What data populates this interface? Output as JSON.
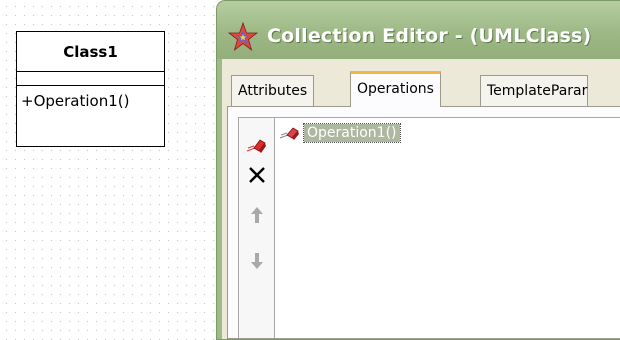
{
  "uml_class": {
    "name": "Class1",
    "operations": [
      "+Operation1()"
    ]
  },
  "window": {
    "title": "Collection Editor - (UMLClass)",
    "icon": "star-icon"
  },
  "tabs": [
    {
      "label": "Attributes",
      "active": false
    },
    {
      "label": "Operations",
      "active": true
    },
    {
      "label": "TemplateParar",
      "active": false
    }
  ],
  "toolbar": {
    "items": [
      {
        "icon": "add-operation-icon",
        "enabled": true
      },
      {
        "icon": "delete-icon",
        "enabled": true
      },
      {
        "icon": "move-up-icon",
        "enabled": false
      },
      {
        "icon": "move-down-icon",
        "enabled": false
      }
    ]
  },
  "operations_list": {
    "items": [
      {
        "label": "Operation1()",
        "icon": "operation-icon",
        "selected": true
      }
    ]
  },
  "colors": {
    "title_bar": "#9db885",
    "selection": "#aeb7a0",
    "active_tab_accent": "#f2b64d"
  }
}
